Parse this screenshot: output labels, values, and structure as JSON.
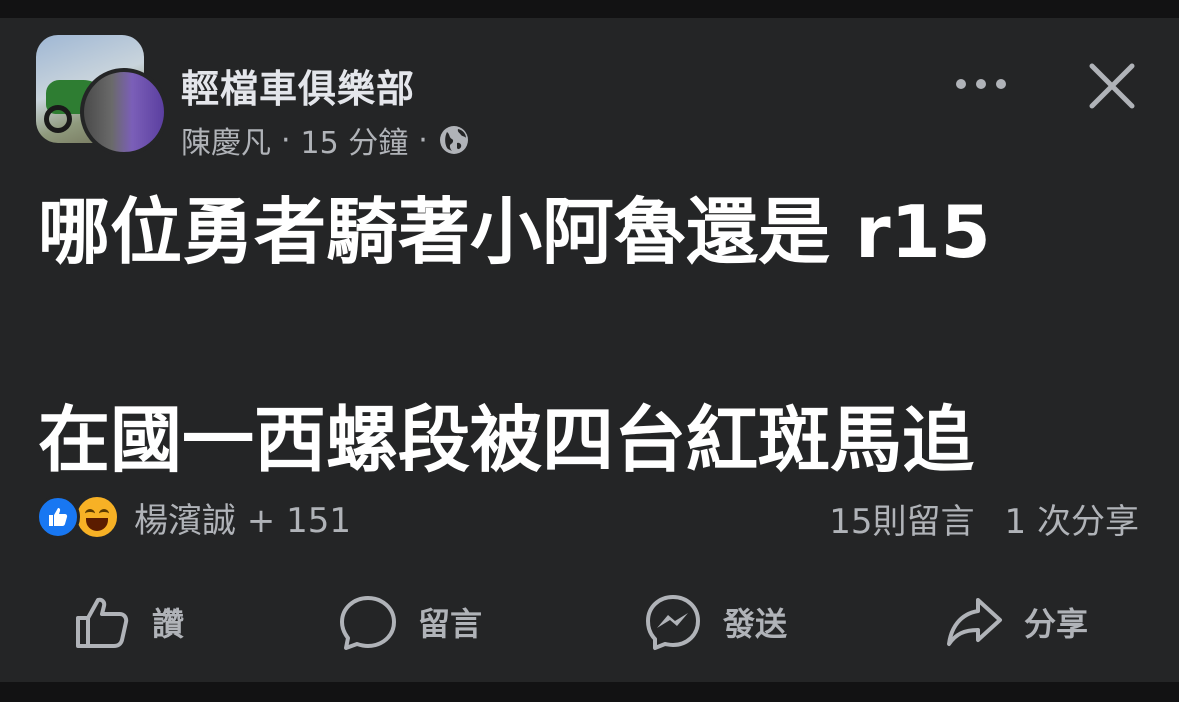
{
  "post": {
    "group_name": "輕檔車俱樂部",
    "author": "陳慶凡",
    "time": "15 分鐘",
    "separator": "·",
    "lines": [
      "哪位勇者騎著小阿魯還是 r15",
      "在國一西螺段被四台紅斑馬追"
    ]
  },
  "reactions": {
    "names": "楊濱誠 + 151",
    "comments": "15則留言",
    "shares": "1 次分享"
  },
  "actions": {
    "like": "讚",
    "comment": "留言",
    "send": "發送",
    "share": "分享"
  },
  "icons": [
    "globe-icon",
    "more-icon",
    "close-icon",
    "like-icon",
    "haha-icon",
    "comment-icon",
    "messenger-icon",
    "share-icon"
  ],
  "colors": {
    "background": "#242526",
    "text": "#e4e6eb",
    "muted": "#b0b3b8",
    "like_blue": "#1877f2",
    "haha_yellow": "#f7b125"
  }
}
